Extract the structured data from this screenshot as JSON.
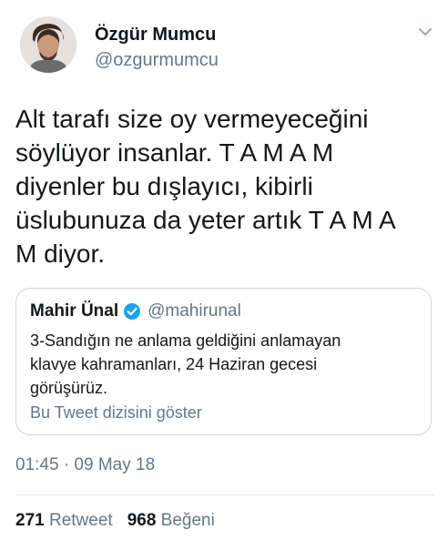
{
  "author": {
    "name": "Özgür Mumcu",
    "handle": "@ozgurmumcu"
  },
  "tweet": {
    "text": "Alt tarafı size oy vermeyeceğini\nsöylüyor insanlar. T A M A M\ndiyenler bu dışlayıcı, kibirli\nüslubunuza da yeter artık T A M A\nM diyor."
  },
  "quoted_tweet": {
    "name": "Mahir Ünal",
    "handle": "@mahirunal",
    "text": "3-Sandığın ne anlama geldiğini anlamayan\nklavye kahramanları, 24 Haziran gecesi\ngörüşürüz.",
    "thread_link": "Bu Tweet dizisini göster"
  },
  "timestamp": "01:45 · 09 May 18",
  "stats": {
    "retweets_count": "271",
    "retweets_label": "Retweet",
    "likes_count": "968",
    "likes_label": "Beğeni"
  },
  "colors": {
    "text": "#14171a",
    "secondary": "#657786",
    "verified": "#1da1f2",
    "border": "#ccd6dd"
  },
  "icons": {
    "menu": "chevron-down-icon",
    "verified": "verified-badge-icon"
  }
}
